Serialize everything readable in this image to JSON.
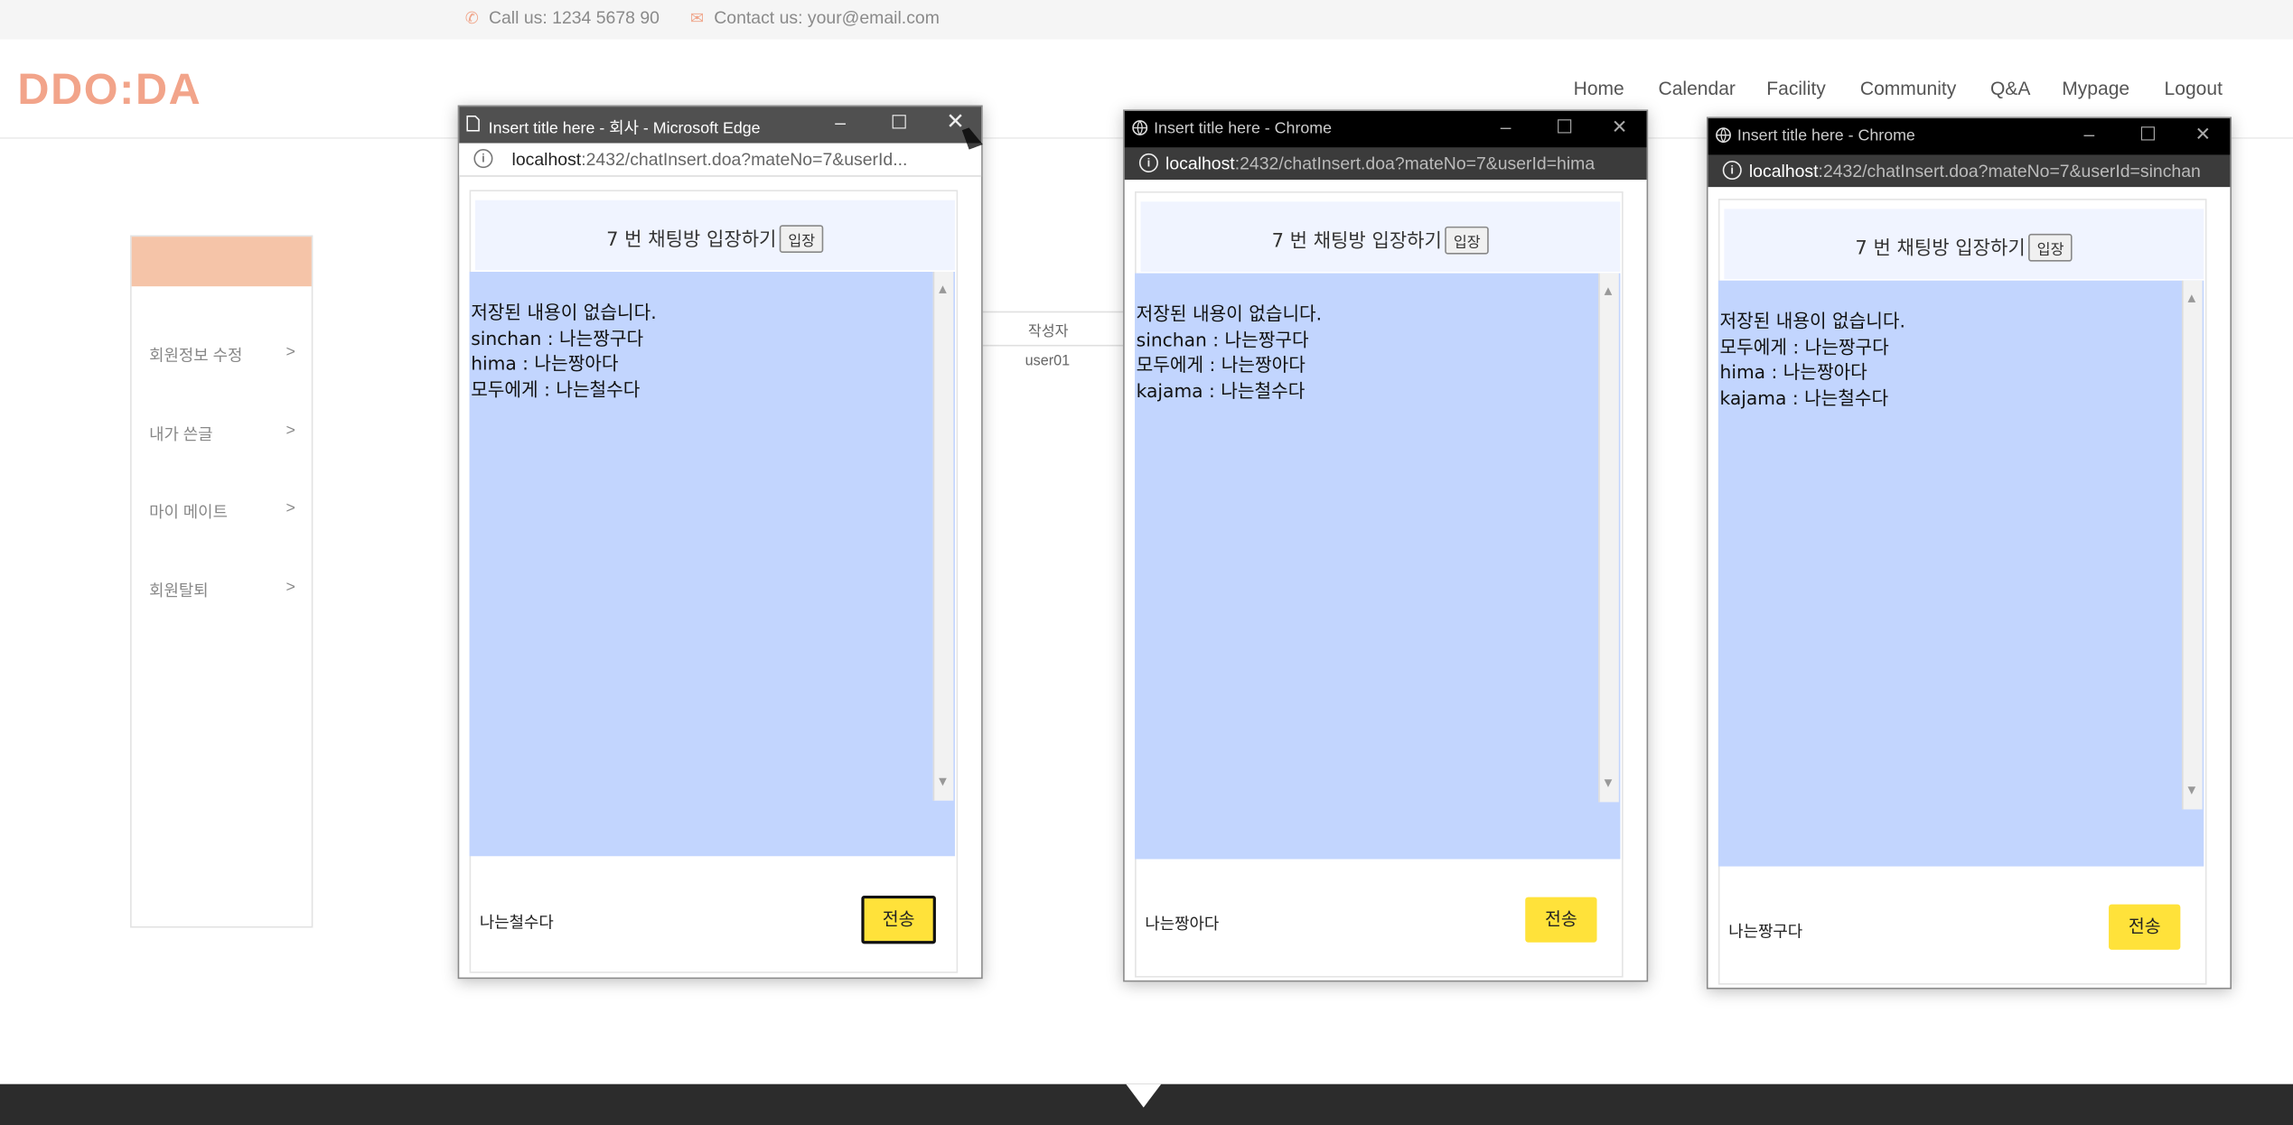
{
  "topbar": {
    "call": "Call us: 1234 5678 90",
    "contact": "Contact us: your@email.com"
  },
  "logo": "DDO:DA",
  "nav": [
    "Home",
    "Calendar",
    "Facility",
    "Community",
    "Q&A",
    "Mypage",
    "Logout"
  ],
  "sidebar": {
    "items": [
      {
        "label": "회원정보 수정",
        "arrow": ">"
      },
      {
        "label": "내가 쓴글",
        "arrow": ">"
      },
      {
        "label": "마이 메이트",
        "arrow": ">"
      },
      {
        "label": "회원탈퇴",
        "arrow": ">"
      }
    ]
  },
  "table": {
    "header": "작성자",
    "cell": "user01"
  },
  "windows": [
    {
      "title": "Insert title here - 회사 - Microsoft Edge",
      "host": "localhost",
      "url_rest": ":2432/chatInsert.doa?mateNo=7&userId...",
      "room_title": "7 번 채팅방 입장하기",
      "enter": "입장",
      "messages": [
        "저장된 내용이 없습니다.",
        "sinchan : 나는짱구다",
        "hima : 나는짱아다",
        "모두에게 : 나는철수다"
      ],
      "input_value": "나는철수다",
      "send": "전송"
    },
    {
      "title": "Insert title here - Chrome",
      "host": "localhost",
      "url_rest": ":2432/chatInsert.doa?mateNo=7&userId=hima",
      "room_title": "7 번 채팅방 입장하기",
      "enter": "입장",
      "messages": [
        "저장된 내용이 없습니다.",
        "sinchan : 나는짱구다",
        "모두에게 : 나는짱아다",
        "kajama : 나는철수다"
      ],
      "input_value": "나는짱아다",
      "send": "전송"
    },
    {
      "title": "Insert title here - Chrome",
      "host": "localhost",
      "url_rest": ":2432/chatInsert.doa?mateNo=7&userId=sinchan",
      "room_title": "7 번 채팅방 입장하기",
      "enter": "입장",
      "messages": [
        "저장된 내용이 없습니다.",
        "모두에게 : 나는짱구다",
        "hima : 나는짱아다",
        "kajama : 나는철수다"
      ],
      "input_value": "나는짱구다",
      "send": "전송"
    }
  ],
  "colors": {
    "accent": "#f2a48a",
    "chat_bg": "#c2d5fe",
    "send": "#ffe23a",
    "edge_title": "#505050",
    "chrome_title": "#000000"
  }
}
